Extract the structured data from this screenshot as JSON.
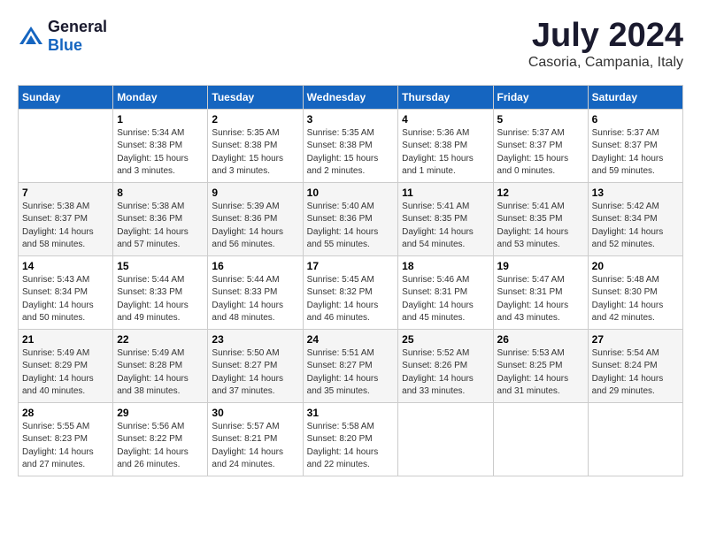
{
  "logo": {
    "text_general": "General",
    "text_blue": "Blue"
  },
  "title": {
    "month_year": "July 2024",
    "location": "Casoria, Campania, Italy"
  },
  "calendar": {
    "headers": [
      "Sunday",
      "Monday",
      "Tuesday",
      "Wednesday",
      "Thursday",
      "Friday",
      "Saturday"
    ],
    "weeks": [
      [
        {
          "day": "",
          "sunrise": "",
          "sunset": "",
          "daylight": ""
        },
        {
          "day": "1",
          "sunrise": "Sunrise: 5:34 AM",
          "sunset": "Sunset: 8:38 PM",
          "daylight": "Daylight: 15 hours and 3 minutes."
        },
        {
          "day": "2",
          "sunrise": "Sunrise: 5:35 AM",
          "sunset": "Sunset: 8:38 PM",
          "daylight": "Daylight: 15 hours and 3 minutes."
        },
        {
          "day": "3",
          "sunrise": "Sunrise: 5:35 AM",
          "sunset": "Sunset: 8:38 PM",
          "daylight": "Daylight: 15 hours and 2 minutes."
        },
        {
          "day": "4",
          "sunrise": "Sunrise: 5:36 AM",
          "sunset": "Sunset: 8:38 PM",
          "daylight": "Daylight: 15 hours and 1 minute."
        },
        {
          "day": "5",
          "sunrise": "Sunrise: 5:37 AM",
          "sunset": "Sunset: 8:37 PM",
          "daylight": "Daylight: 15 hours and 0 minutes."
        },
        {
          "day": "6",
          "sunrise": "Sunrise: 5:37 AM",
          "sunset": "Sunset: 8:37 PM",
          "daylight": "Daylight: 14 hours and 59 minutes."
        }
      ],
      [
        {
          "day": "7",
          "sunrise": "Sunrise: 5:38 AM",
          "sunset": "Sunset: 8:37 PM",
          "daylight": "Daylight: 14 hours and 58 minutes."
        },
        {
          "day": "8",
          "sunrise": "Sunrise: 5:38 AM",
          "sunset": "Sunset: 8:36 PM",
          "daylight": "Daylight: 14 hours and 57 minutes."
        },
        {
          "day": "9",
          "sunrise": "Sunrise: 5:39 AM",
          "sunset": "Sunset: 8:36 PM",
          "daylight": "Daylight: 14 hours and 56 minutes."
        },
        {
          "day": "10",
          "sunrise": "Sunrise: 5:40 AM",
          "sunset": "Sunset: 8:36 PM",
          "daylight": "Daylight: 14 hours and 55 minutes."
        },
        {
          "day": "11",
          "sunrise": "Sunrise: 5:41 AM",
          "sunset": "Sunset: 8:35 PM",
          "daylight": "Daylight: 14 hours and 54 minutes."
        },
        {
          "day": "12",
          "sunrise": "Sunrise: 5:41 AM",
          "sunset": "Sunset: 8:35 PM",
          "daylight": "Daylight: 14 hours and 53 minutes."
        },
        {
          "day": "13",
          "sunrise": "Sunrise: 5:42 AM",
          "sunset": "Sunset: 8:34 PM",
          "daylight": "Daylight: 14 hours and 52 minutes."
        }
      ],
      [
        {
          "day": "14",
          "sunrise": "Sunrise: 5:43 AM",
          "sunset": "Sunset: 8:34 PM",
          "daylight": "Daylight: 14 hours and 50 minutes."
        },
        {
          "day": "15",
          "sunrise": "Sunrise: 5:44 AM",
          "sunset": "Sunset: 8:33 PM",
          "daylight": "Daylight: 14 hours and 49 minutes."
        },
        {
          "day": "16",
          "sunrise": "Sunrise: 5:44 AM",
          "sunset": "Sunset: 8:33 PM",
          "daylight": "Daylight: 14 hours and 48 minutes."
        },
        {
          "day": "17",
          "sunrise": "Sunrise: 5:45 AM",
          "sunset": "Sunset: 8:32 PM",
          "daylight": "Daylight: 14 hours and 46 minutes."
        },
        {
          "day": "18",
          "sunrise": "Sunrise: 5:46 AM",
          "sunset": "Sunset: 8:31 PM",
          "daylight": "Daylight: 14 hours and 45 minutes."
        },
        {
          "day": "19",
          "sunrise": "Sunrise: 5:47 AM",
          "sunset": "Sunset: 8:31 PM",
          "daylight": "Daylight: 14 hours and 43 minutes."
        },
        {
          "day": "20",
          "sunrise": "Sunrise: 5:48 AM",
          "sunset": "Sunset: 8:30 PM",
          "daylight": "Daylight: 14 hours and 42 minutes."
        }
      ],
      [
        {
          "day": "21",
          "sunrise": "Sunrise: 5:49 AM",
          "sunset": "Sunset: 8:29 PM",
          "daylight": "Daylight: 14 hours and 40 minutes."
        },
        {
          "day": "22",
          "sunrise": "Sunrise: 5:49 AM",
          "sunset": "Sunset: 8:28 PM",
          "daylight": "Daylight: 14 hours and 38 minutes."
        },
        {
          "day": "23",
          "sunrise": "Sunrise: 5:50 AM",
          "sunset": "Sunset: 8:27 PM",
          "daylight": "Daylight: 14 hours and 37 minutes."
        },
        {
          "day": "24",
          "sunrise": "Sunrise: 5:51 AM",
          "sunset": "Sunset: 8:27 PM",
          "daylight": "Daylight: 14 hours and 35 minutes."
        },
        {
          "day": "25",
          "sunrise": "Sunrise: 5:52 AM",
          "sunset": "Sunset: 8:26 PM",
          "daylight": "Daylight: 14 hours and 33 minutes."
        },
        {
          "day": "26",
          "sunrise": "Sunrise: 5:53 AM",
          "sunset": "Sunset: 8:25 PM",
          "daylight": "Daylight: 14 hours and 31 minutes."
        },
        {
          "day": "27",
          "sunrise": "Sunrise: 5:54 AM",
          "sunset": "Sunset: 8:24 PM",
          "daylight": "Daylight: 14 hours and 29 minutes."
        }
      ],
      [
        {
          "day": "28",
          "sunrise": "Sunrise: 5:55 AM",
          "sunset": "Sunset: 8:23 PM",
          "daylight": "Daylight: 14 hours and 27 minutes."
        },
        {
          "day": "29",
          "sunrise": "Sunrise: 5:56 AM",
          "sunset": "Sunset: 8:22 PM",
          "daylight": "Daylight: 14 hours and 26 minutes."
        },
        {
          "day": "30",
          "sunrise": "Sunrise: 5:57 AM",
          "sunset": "Sunset: 8:21 PM",
          "daylight": "Daylight: 14 hours and 24 minutes."
        },
        {
          "day": "31",
          "sunrise": "Sunrise: 5:58 AM",
          "sunset": "Sunset: 8:20 PM",
          "daylight": "Daylight: 14 hours and 22 minutes."
        },
        {
          "day": "",
          "sunrise": "",
          "sunset": "",
          "daylight": ""
        },
        {
          "day": "",
          "sunrise": "",
          "sunset": "",
          "daylight": ""
        },
        {
          "day": "",
          "sunrise": "",
          "sunset": "",
          "daylight": ""
        }
      ]
    ]
  }
}
